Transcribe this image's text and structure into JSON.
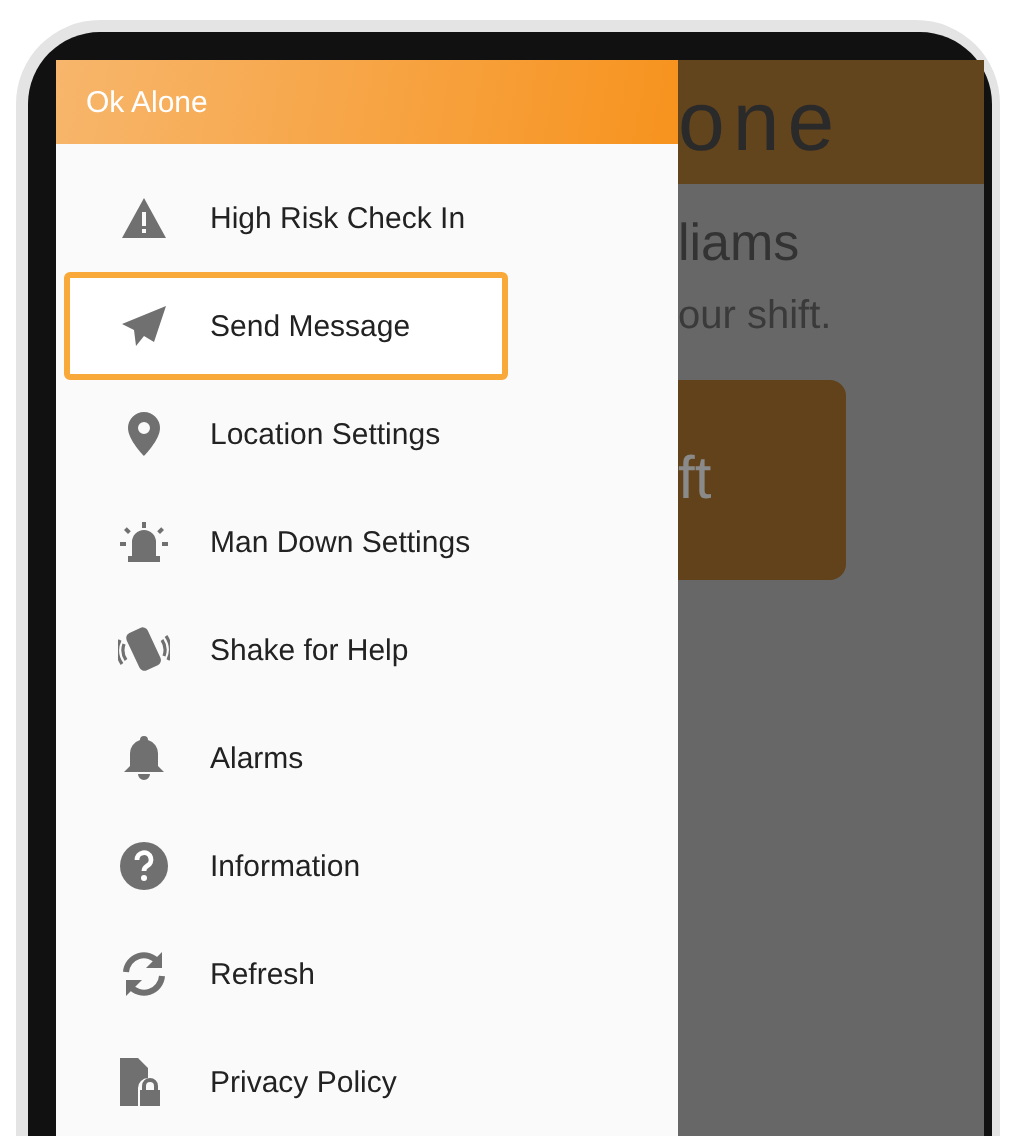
{
  "drawer": {
    "title": "Ok Alone",
    "items": [
      {
        "label": "High Risk Check In",
        "selected": false
      },
      {
        "label": "Send Message",
        "selected": true
      },
      {
        "label": "Location Settings",
        "selected": false
      },
      {
        "label": "Man Down Settings",
        "selected": false
      },
      {
        "label": "Shake for Help",
        "selected": false
      },
      {
        "label": "Alarms",
        "selected": false
      },
      {
        "label": "Information",
        "selected": false
      },
      {
        "label": "Refresh",
        "selected": false
      },
      {
        "label": "Privacy Policy",
        "selected": false
      }
    ]
  },
  "background_screen": {
    "app_title": "one",
    "greeting": "liams",
    "subtitle": "our shift.",
    "button": "ft"
  }
}
